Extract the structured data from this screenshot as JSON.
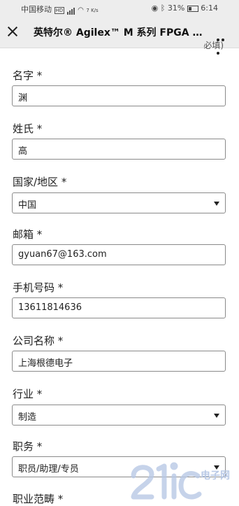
{
  "status_bar": {
    "carrier": "中国移动",
    "hd": "HD",
    "speed": "7 K/s",
    "battery": "31%",
    "time": "6:14"
  },
  "title_bar": {
    "title": "英特尔® Agilex™ M 系列 FPGA 打..."
  },
  "partial_top_text": "必填)",
  "form": {
    "fields": [
      {
        "label": "名字 *",
        "value": "渊",
        "type": "text"
      },
      {
        "label": "姓氏 *",
        "value": "高",
        "type": "text"
      },
      {
        "label": "国家/地区 *",
        "value": "中国",
        "type": "select"
      },
      {
        "label": "邮箱 *",
        "value": "gyuan67@163.com",
        "type": "text"
      },
      {
        "label": "手机号码 *",
        "value": "13611814636",
        "type": "text"
      },
      {
        "label": "公司名称 *",
        "value": "上海根德电子",
        "type": "text"
      },
      {
        "label": "行业 *",
        "value": "制造",
        "type": "select"
      },
      {
        "label": "职务 *",
        "value": "职员/助理/专员",
        "type": "select"
      },
      {
        "label": "职业范畴 *",
        "value": "",
        "type": "select"
      }
    ]
  },
  "watermark": {
    "text": "21ic电子网",
    "color": "#b9c9e6"
  },
  "colors": {
    "bar_bg": "#ededed",
    "border": "#8a8a8a",
    "text": "#222222"
  }
}
